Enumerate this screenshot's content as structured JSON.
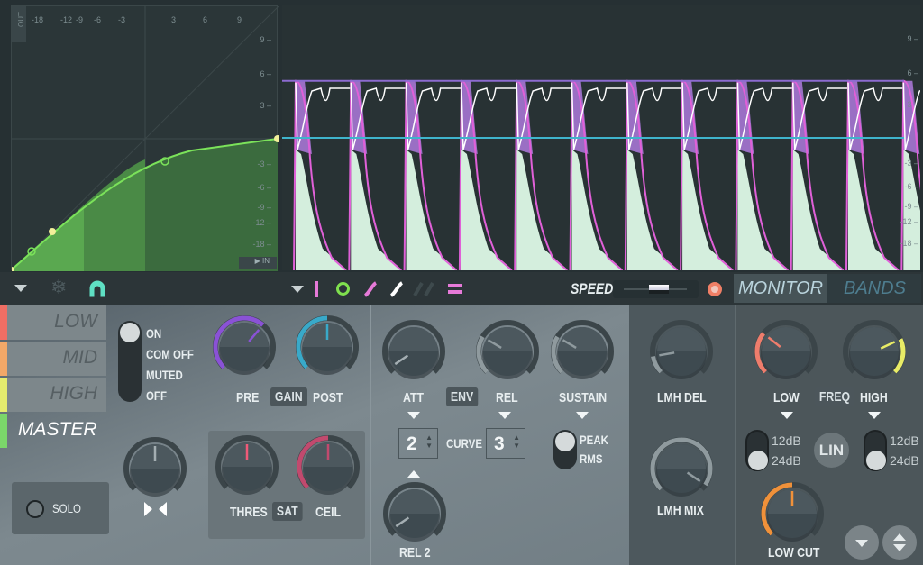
{
  "graph": {
    "out_label": "OUT",
    "in_label": "IN",
    "x_ticks": [
      "-18",
      "-12",
      "-9",
      "-6",
      "-3",
      "3",
      "6",
      "9"
    ],
    "y_ticks": [
      "9",
      "6",
      "3",
      "-3",
      "-6",
      "-9",
      "-12",
      "-18"
    ]
  },
  "wave": {
    "y_ticks": [
      "9",
      "6",
      "3",
      "-3",
      "-6",
      "-9",
      "-12",
      "-18"
    ],
    "threshold_db": 0,
    "ceiling_db": 5.5
  },
  "toolbar": {
    "left_icons": [
      "dropdown-icon",
      "snowflake-icon",
      "magnet-icon"
    ],
    "mid_icons": [
      "dropdown-icon",
      "bar-icon",
      "circle-icon",
      "pink-curve-icon",
      "white-curve-icon",
      "dim-curves-icon",
      "equals-icon"
    ],
    "speed_label": "SPEED",
    "speed_value": 0.55,
    "monitor_label": "MONITOR",
    "bands_label": "BANDS"
  },
  "bands": [
    {
      "label": "LOW",
      "color": "#ef6e64"
    },
    {
      "label": "MID",
      "color": "#f2a868"
    },
    {
      "label": "HIGH",
      "color": "#e5ec6e"
    },
    {
      "label": "MASTER",
      "color": "#7bd66a"
    }
  ],
  "state": {
    "options": [
      "ON",
      "COM OFF",
      "MUTED",
      "OFF"
    ],
    "selected": "ON"
  },
  "solo_label": "SOLO",
  "gain": {
    "pre": "PRE",
    "label": "GAIN",
    "post": "POST"
  },
  "sat": {
    "thres": "THRES",
    "label": "SAT",
    "ceil": "CEIL"
  },
  "env": {
    "att": "ATT",
    "label": "ENV",
    "rel": "REL",
    "sustain": "SUSTAIN",
    "rel2": "REL 2",
    "curve": "CURVE",
    "curve_att": "2",
    "curve_rel": "3",
    "peak": "PEAK",
    "rms": "RMS"
  },
  "lmh": {
    "del": "LMH DEL",
    "mix": "LMH MIX"
  },
  "freq": {
    "low": "LOW",
    "label": "FREQ",
    "high": "HIGH",
    "lin": "LIN",
    "low_12": "12dB",
    "low_24": "24dB",
    "high_12": "12dB",
    "high_24": "24dB",
    "low_cut": "LOW CUT"
  },
  "knobs": {
    "pre": {
      "value": 0.65,
      "color": "#8a52d6",
      "arc": "min"
    },
    "post": {
      "value": 0.5,
      "color": "#39a9c9",
      "arc": "min"
    },
    "pan": {
      "value": 0.5,
      "color": "#9aa4a8",
      "arc": "none"
    },
    "thres": {
      "value": 0.5,
      "color": "#ef5a78",
      "arc": "none"
    },
    "ceil": {
      "value": 0.5,
      "color": "#c14a6e",
      "arc": "min"
    },
    "att": {
      "value": 0.04,
      "color": "#8f9a9e",
      "arc": "none"
    },
    "rel": {
      "value": 0.28,
      "color": "#8f9a9e",
      "arc": "min"
    },
    "sustain": {
      "value": 0.28,
      "color": "#8f9a9e",
      "arc": "min"
    },
    "rel2": {
      "value": 0.04,
      "color": "#8f9a9e",
      "arc": "none"
    },
    "lmh_del": {
      "value": 0.13,
      "color": "#8f9a9e",
      "arc": "min"
    },
    "lmh_mix": {
      "value": 0.96,
      "color": "#8f9a9e",
      "arc": "min"
    },
    "low": {
      "value": 0.31,
      "color": "#ef7d6c",
      "arc": "min"
    },
    "high": {
      "value": 0.74,
      "color": "#e9ec66",
      "arc": "max"
    },
    "low_cut": {
      "value": 0.5,
      "color": "#f0913a",
      "arc": "min"
    }
  }
}
